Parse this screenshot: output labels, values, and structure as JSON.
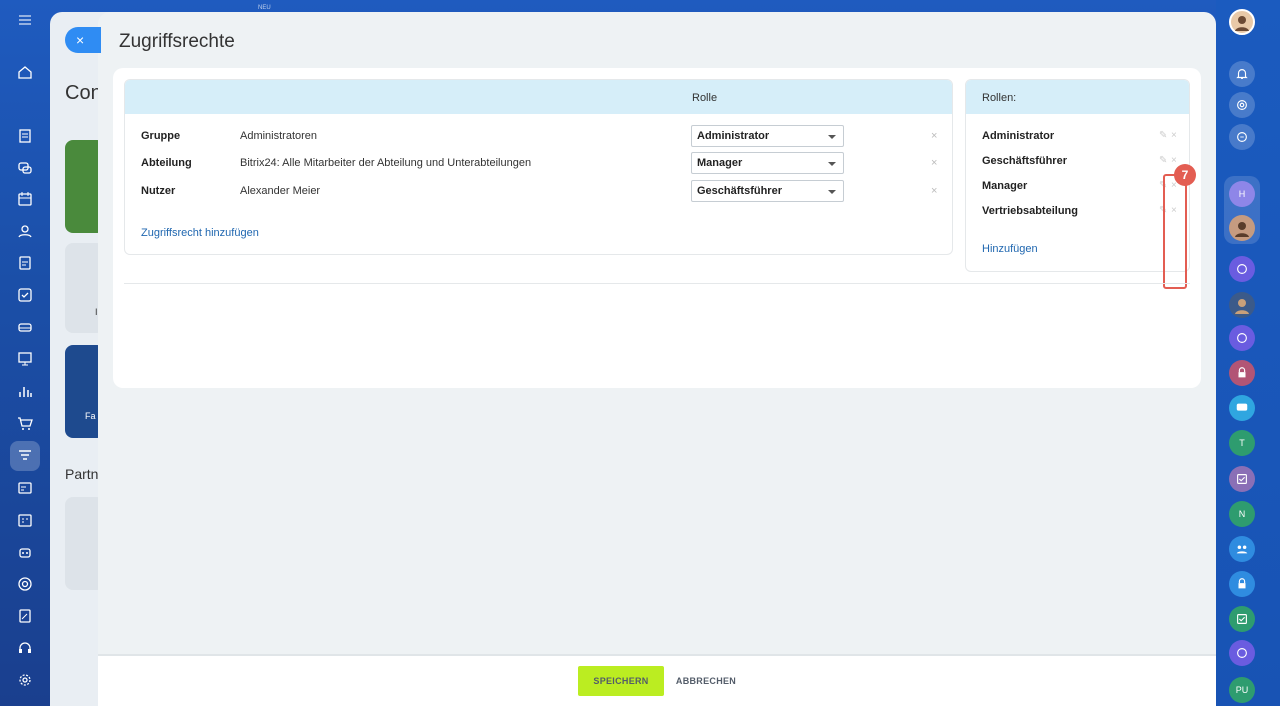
{
  "background": {
    "title_fragment": "Con",
    "partner_fragment": "Partn",
    "card_fragment_1": "I",
    "card_fragment_2": "Fa",
    "neu": "NEU"
  },
  "slider": {
    "title": "Zugriffsrechte",
    "close_icon": "×"
  },
  "permissions": {
    "header_role": "Rolle",
    "rows": [
      {
        "type": "Gruppe",
        "name": "Administratoren",
        "role": "Administrator"
      },
      {
        "type": "Abteilung",
        "name": "Bitrix24: Alle Mitarbeiter der Abteilung und Unterabteilungen",
        "role": "Manager"
      },
      {
        "type": "Nutzer",
        "name": "Alexander Meier",
        "role": "Geschäftsführer"
      }
    ],
    "delete_icon": "×",
    "add_link": "Zugriffsrecht hinzufügen"
  },
  "roles": {
    "header": "Rollen:",
    "items": [
      "Administrator",
      "Geschäftsführer",
      "Manager",
      "Vertriebsabteilung"
    ],
    "edit_icon": "✎",
    "delete_icon": "×",
    "add_link": "Hinzufügen"
  },
  "annotation": {
    "badge": "7",
    "color": "#e35d52"
  },
  "footer": {
    "save": "SPEICHERN",
    "cancel": "ABBRECHEN"
  },
  "right_sidebar": {
    "letters": [
      "H",
      "T",
      "N",
      "PU"
    ]
  },
  "colors": {
    "accent": "#2f8cf3",
    "save_button": "#bbed21",
    "header_bg": "#d6eef9",
    "link": "#2067b0"
  }
}
